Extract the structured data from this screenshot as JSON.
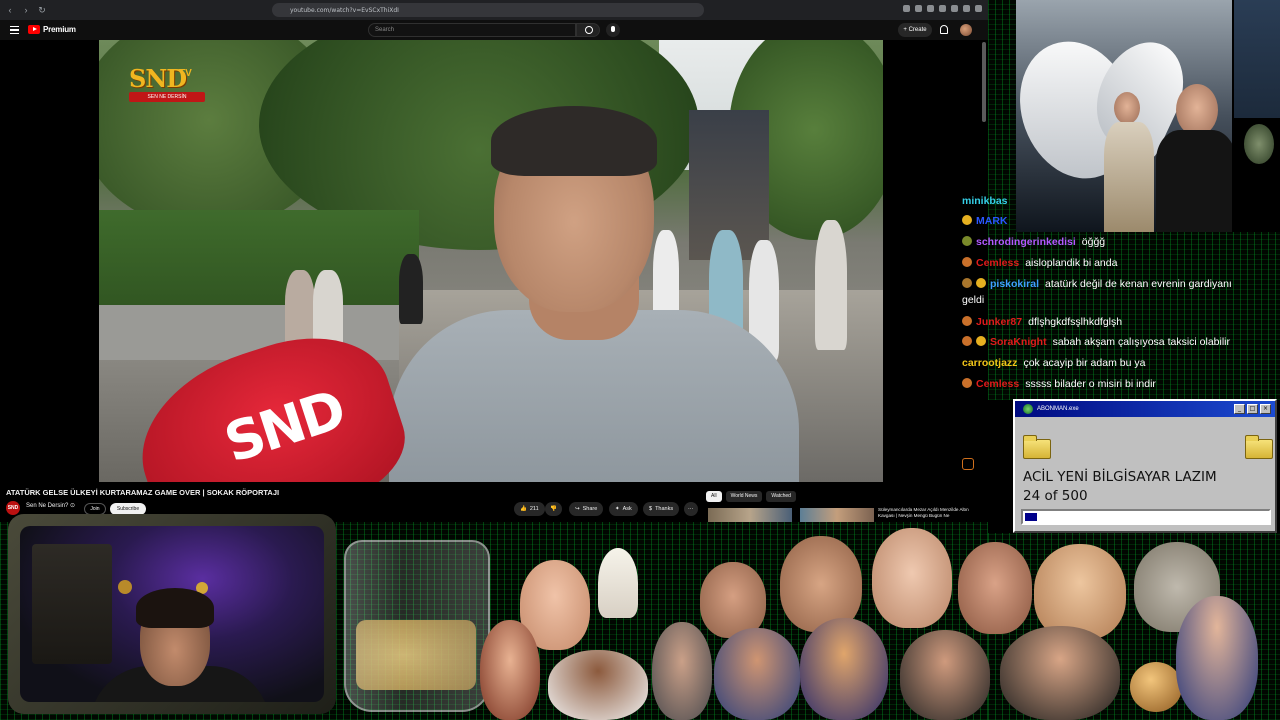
{
  "browser": {
    "url": "youtube.com/watch?v=EvSCxThiXdI"
  },
  "youtube": {
    "brand": "Premium",
    "search_placeholder": "Search",
    "create_label": "Create"
  },
  "video": {
    "logo_text": "SND",
    "logo_tv": "TV",
    "logo_ribbon": "SEN NE DERSİN",
    "mic_text": "SND",
    "title": "ATATÜRK GELSE ÜLKEYİ KURTARAMAZ GAME OVER | SOKAK RÖPORTAJI",
    "channel_badge": "SND",
    "channel_name": "Sen Ne Dersin? ⊙",
    "join_label": "Join",
    "subscribe_label": "Subscribe",
    "like_count": "211",
    "share_label": "Share",
    "ask_label": "Ask",
    "thanks_label": "Thanks",
    "more_label": "⋯"
  },
  "recommendations": {
    "chips": [
      "All",
      "World News",
      "Watched"
    ],
    "first_title": "Süleymancılarda Mezar Açıldı Menzilde Altın Kavgası | Nevşin Mengü Bugün Ne"
  },
  "chat": {
    "messages": [
      {
        "user": "minikbas",
        "message": "",
        "color": "#35d0e8"
      },
      {
        "user": "MARK",
        "message": "",
        "color": "#2a57ff"
      },
      {
        "user": "schrodingerinkedisi",
        "message": "öğğğ",
        "color": "#b259ff"
      },
      {
        "user": "Cemless",
        "message": "aisloplandik bi anda",
        "color": "#e01b1b"
      },
      {
        "user": "piskokiral",
        "message": "atatürk değil de kenan evrenin gardiyanı",
        "color": "#3fa0ff"
      },
      {
        "user": "",
        "message": "geldi",
        "color": "#ffffff"
      },
      {
        "user": "Junker87",
        "message": "dflşhgkdfsşlhkdfglşh",
        "color": "#e01b1b"
      },
      {
        "user": "SoraKnight",
        "message": "sabah akşam çalışıyosa taksici olabilir",
        "color": "#e01b1b"
      },
      {
        "user": "carrootjazz",
        "message": "çok acayip bir adam bu ya",
        "color": "#f0c419"
      },
      {
        "user": "Cemless",
        "message": "sssss bilader o misiri bi indir",
        "color": "#e01b1b"
      }
    ]
  },
  "donation_popup": {
    "title": "ABONMAN.exe",
    "line1": "ACİL YENİ BİLGİSAYAR LAZIM",
    "line2": "24 of 500",
    "progress": 0.048
  },
  "colors": {
    "youtube_red": "#ff0000",
    "popup_titlebar": "#000a80",
    "matrix_green": "#00aa28"
  }
}
